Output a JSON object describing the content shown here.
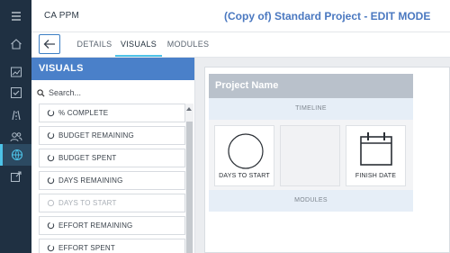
{
  "app": {
    "name": "CA PPM"
  },
  "header": {
    "title": "(Copy of) Standard Project - EDIT MODE"
  },
  "tabs": [
    {
      "label": "DETAILS",
      "active": false
    },
    {
      "label": "VISUALS",
      "active": true
    },
    {
      "label": "MODULES",
      "active": false
    }
  ],
  "rail": {
    "items": [
      "menu-icon",
      "home-icon",
      "chart-icon",
      "checklist-icon",
      "roadmap-icon",
      "people-icon",
      "globe-icon",
      "external-link-icon"
    ],
    "active": "globe-icon"
  },
  "visuals_panel": {
    "header": "VISUALS",
    "search_placeholder": "Search...",
    "items": [
      {
        "label": "% COMPLETE",
        "enabled": true
      },
      {
        "label": "BUDGET REMAINING",
        "enabled": true
      },
      {
        "label": "BUDGET SPENT",
        "enabled": true
      },
      {
        "label": "DAYS REMAINING",
        "enabled": true
      },
      {
        "label": "DAYS TO START",
        "enabled": false
      },
      {
        "label": "EFFORT REMAINING",
        "enabled": true
      },
      {
        "label": "EFFORT SPENT",
        "enabled": true
      }
    ]
  },
  "canvas": {
    "project_name": "Project Name",
    "timeline_label": "TIMELINE",
    "slots": [
      {
        "label": "DAYS TO START",
        "icon": "circle-icon"
      },
      {
        "label": "",
        "icon": ""
      },
      {
        "label": "FINISH DATE",
        "icon": "calendar-icon"
      }
    ],
    "modules_label": "MODULES"
  },
  "colors": {
    "rail": "#1f3042",
    "accent": "#4dc3e8",
    "panel_header": "#4a80c9",
    "title": "#4a78c0"
  }
}
